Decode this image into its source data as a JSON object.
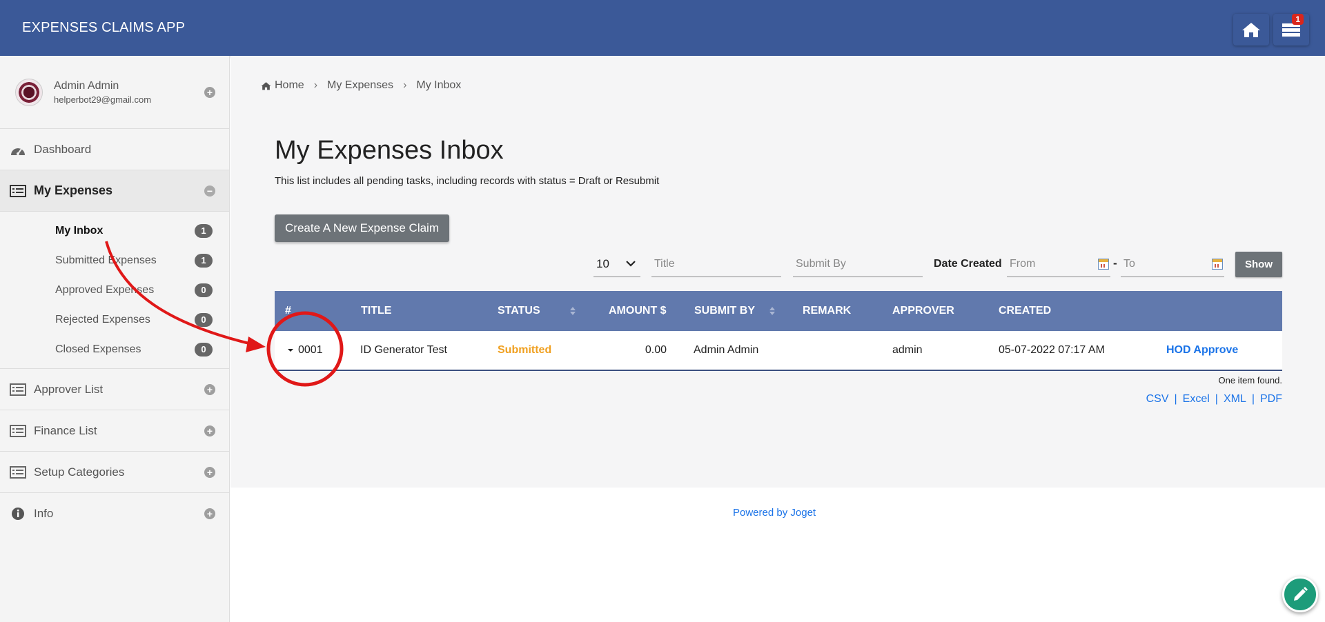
{
  "header": {
    "title": "EXPENSES CLAIMS APP",
    "home_icon": "home-icon",
    "inbox_icon": "inbox-icon",
    "inbox_count": "1",
    "bg_color": "#3b5998"
  },
  "sidebar": {
    "profile": {
      "name": "Admin Admin",
      "email": "helperbot29@gmail.com"
    },
    "items": [
      {
        "label": "Dashboard",
        "icon": "dashboard-icon"
      },
      {
        "label": "My Expenses",
        "icon": "list-icon",
        "active": true
      },
      {
        "label": "Approver List",
        "icon": "list-icon"
      },
      {
        "label": "Finance List",
        "icon": "list-icon"
      },
      {
        "label": "Setup Categories",
        "icon": "list-icon"
      },
      {
        "label": "Info",
        "icon": "info-icon"
      }
    ],
    "sub_items": [
      {
        "label": "My Inbox",
        "count": "1",
        "active": true
      },
      {
        "label": "Submitted Expenses",
        "count": "1"
      },
      {
        "label": "Approved Expenses",
        "count": "0"
      },
      {
        "label": "Rejected Expenses",
        "count": "0"
      },
      {
        "label": "Closed Expenses",
        "count": "0"
      }
    ]
  },
  "breadcrumb": [
    "Home",
    "My Expenses",
    "My Inbox"
  ],
  "page": {
    "title": "My Expenses Inbox",
    "description": "This list includes all pending tasks, including records with status = Draft or Resubmit",
    "create_button": "Create A New Expense Claim"
  },
  "filters": {
    "page_size": "10",
    "title_placeholder": "Title",
    "submit_by_placeholder": "Submit By",
    "date_created_label": "Date Created",
    "from_placeholder": "From",
    "to_placeholder": "To",
    "dash": "-",
    "show_button": "Show"
  },
  "table": {
    "columns": [
      "#",
      "TITLE",
      "STATUS",
      "AMOUNT $",
      "SUBMIT BY",
      "REMARK",
      "APPROVER",
      "CREATED"
    ],
    "rows": [
      {
        "id": "0001",
        "title": "ID Generator Test",
        "status": "Submitted",
        "amount": "0.00",
        "submit_by": "Admin Admin",
        "remark": "",
        "approver": "admin",
        "created": "05-07-2022 07:17 AM",
        "action": "HOD Approve"
      }
    ],
    "found_text": "One item found.",
    "exports": [
      "CSV",
      "Excel",
      "XML",
      "PDF"
    ],
    "header_color": "#6179ad",
    "status_color": "#f0a020"
  },
  "footer": {
    "powered_by": "Powered by Joget"
  },
  "fab_icon": "pencil-icon"
}
